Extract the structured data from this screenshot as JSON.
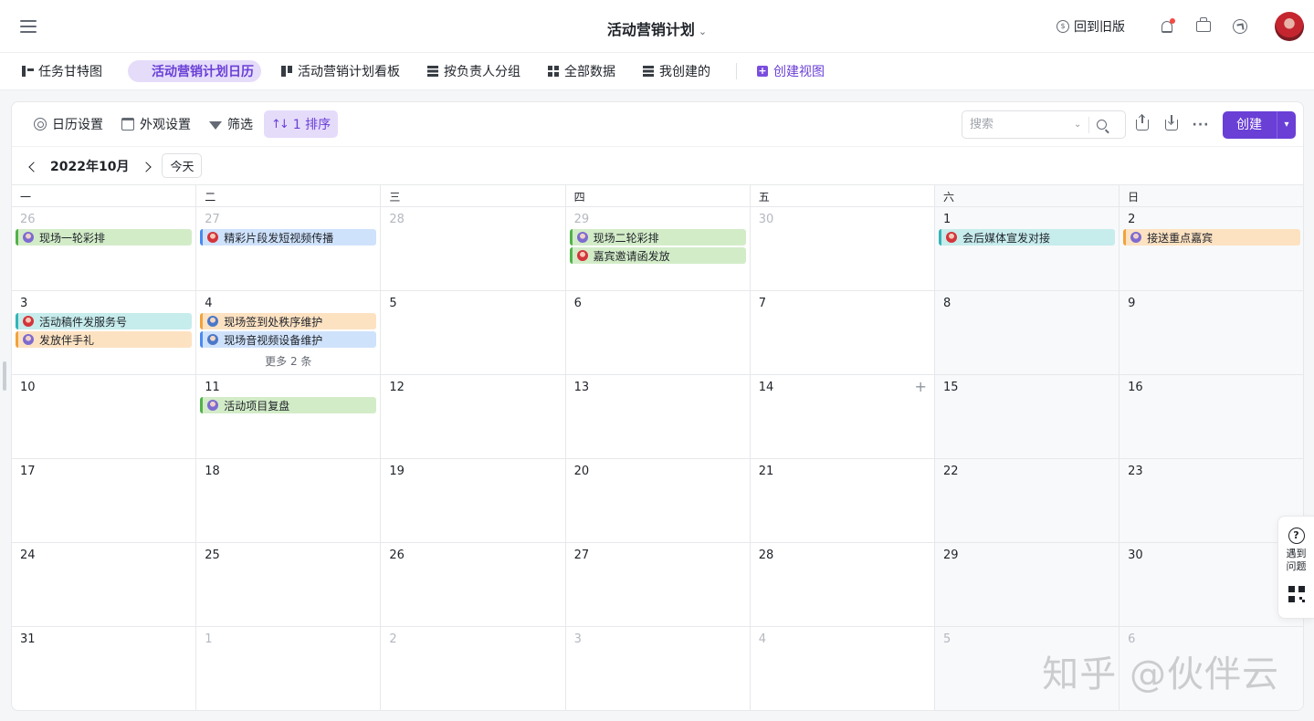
{
  "header": {
    "title": "活动营销计划",
    "old_version": "回到旧版"
  },
  "views": [
    {
      "label": "任务甘特图",
      "icon": "gantt-icon"
    },
    {
      "label": "活动营销计划日历",
      "icon": "calendar-icon",
      "active": true
    },
    {
      "label": "活动营销计划看板",
      "icon": "kanban-icon"
    },
    {
      "label": "按负责人分组",
      "icon": "table-icon"
    },
    {
      "label": "全部数据",
      "icon": "grid-icon"
    },
    {
      "label": "我创建的",
      "icon": "table-icon"
    }
  ],
  "create_view": "创建视图",
  "toolbar": {
    "calendar_settings": "日历设置",
    "appearance": "外观设置",
    "filter": "筛选",
    "sort": "1 排序",
    "search_placeholder": "搜索",
    "create": "创建"
  },
  "nav": {
    "month": "2022年10月",
    "today": "今天"
  },
  "weekdays": [
    "一",
    "二",
    "三",
    "四",
    "五",
    "六",
    "日"
  ],
  "weeks": [
    [
      {
        "num": "26",
        "other": true,
        "events": [
          {
            "title": "现场一轮彩排",
            "color": "green",
            "avatar": "a1"
          }
        ]
      },
      {
        "num": "27",
        "other": true,
        "events": [
          {
            "title": "精彩片段发短视频传播",
            "color": "blue",
            "avatar": "a2"
          }
        ]
      },
      {
        "num": "28",
        "other": true,
        "events": []
      },
      {
        "num": "29",
        "other": true,
        "events": [
          {
            "title": "现场二轮彩排",
            "color": "green",
            "avatar": "a1"
          },
          {
            "title": "嘉宾邀请函发放",
            "color": "green",
            "avatar": "a2"
          }
        ]
      },
      {
        "num": "30",
        "other": true,
        "events": []
      },
      {
        "num": "1",
        "events": [
          {
            "title": "会后媒体宣发对接",
            "color": "cyan",
            "avatar": "a2"
          }
        ]
      },
      {
        "num": "2",
        "events": [
          {
            "title": "接送重点嘉宾",
            "color": "orange",
            "avatar": "a1"
          }
        ]
      }
    ],
    [
      {
        "num": "3",
        "events": [
          {
            "title": "活动稿件发服务号",
            "color": "cyan",
            "avatar": "a2"
          },
          {
            "title": "发放伴手礼",
            "color": "orange",
            "avatar": "a1"
          }
        ]
      },
      {
        "num": "4",
        "events": [
          {
            "title": "现场签到处秩序维护",
            "color": "orange",
            "avatar": "a3"
          },
          {
            "title": "现场音视频设备维护",
            "color": "blue",
            "avatar": "a3"
          }
        ],
        "more": "更多 2 条"
      },
      {
        "num": "5",
        "events": []
      },
      {
        "num": "6",
        "events": []
      },
      {
        "num": "7",
        "events": []
      },
      {
        "num": "8",
        "events": []
      },
      {
        "num": "9",
        "events": []
      }
    ],
    [
      {
        "num": "10",
        "events": []
      },
      {
        "num": "11",
        "events": [
          {
            "title": "活动项目复盘",
            "color": "green",
            "avatar": "a1"
          }
        ]
      },
      {
        "num": "12",
        "events": []
      },
      {
        "num": "13",
        "events": []
      },
      {
        "num": "14",
        "events": [],
        "plus": "+"
      },
      {
        "num": "15",
        "events": []
      },
      {
        "num": "16",
        "events": []
      }
    ],
    [
      {
        "num": "17",
        "events": []
      },
      {
        "num": "18",
        "events": []
      },
      {
        "num": "19",
        "events": []
      },
      {
        "num": "20",
        "events": []
      },
      {
        "num": "21",
        "events": []
      },
      {
        "num": "22",
        "events": []
      },
      {
        "num": "23",
        "events": []
      }
    ],
    [
      {
        "num": "24",
        "events": []
      },
      {
        "num": "25",
        "events": []
      },
      {
        "num": "26",
        "events": []
      },
      {
        "num": "27",
        "events": []
      },
      {
        "num": "28",
        "events": []
      },
      {
        "num": "29",
        "events": []
      },
      {
        "num": "30",
        "events": []
      }
    ],
    [
      {
        "num": "31",
        "events": []
      },
      {
        "num": "1",
        "other": true,
        "events": []
      },
      {
        "num": "2",
        "other": true,
        "events": []
      },
      {
        "num": "3",
        "other": true,
        "events": []
      },
      {
        "num": "4",
        "other": true,
        "events": []
      },
      {
        "num": "5",
        "other": true,
        "events": []
      },
      {
        "num": "6",
        "other": true,
        "events": []
      }
    ]
  ],
  "help": {
    "label": "遇到问题"
  },
  "watermark": "知乎 @伙伴云",
  "colors": {
    "accent": "#6a3fd6",
    "accent_bg": "#e5dcfa",
    "green": "#d3ecc8",
    "blue": "#cfe2fb",
    "cyan": "#c7ecec",
    "orange": "#fde2c2"
  }
}
